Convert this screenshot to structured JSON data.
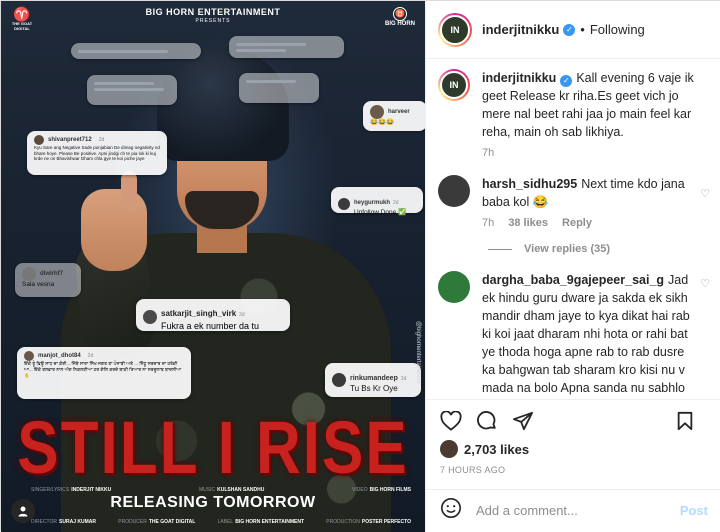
{
  "poster": {
    "presenter": "BIG HORN ENTERTAINMENT",
    "presents": "PRESENTS",
    "left_logo": "THE GOAT DIGITAL",
    "right_logo": "BIG HORN",
    "title": "STILL I RISE",
    "release_text": "RELEASING TOMORROW",
    "credits_top": [
      {
        "k": "SINGER/LYRICS",
        "v": "INDERJIT NIKKU"
      },
      {
        "k": "MUSIC",
        "v": "KULSHAN SANDHU"
      },
      {
        "k": "VIDEO",
        "v": "BIG HORN FILMS"
      }
    ],
    "credits_bottom": [
      {
        "k": "DIRECTOR",
        "v": "SURAJ KUMAR"
      },
      {
        "k": "PRODUCER",
        "v": "THE GOAT DIGITAL"
      },
      {
        "k": "LABEL",
        "v": "BIG HORN ENTERTAINMENT"
      },
      {
        "k": "PRODUCTION",
        "v": "POSTER PERFECTO"
      }
    ],
    "side_handle": "@bighornentertainment",
    "bubbles": {
      "b1_user": "harveer",
      "b2_user": "shivanpreet712",
      "b2_time": "2d",
      "b2_msg": "Kyu Sare ang Negative Sade punjabian De dimag negativity nd bhare hoye. Please Be positive. Apni jindgi ch te pia lok ki kuj krde ne on Bhavishwar Dham chla gye te koi piche jaye",
      "b3_user": "heygurmukh",
      "b3_time": "2d",
      "b3_msg": "Unfollow Done ✅",
      "b4_user": "dlwlrhf7",
      "b4_time": "2d",
      "b4_msg": "Sala vesna",
      "b5_user": "satkarjit_singh_virk",
      "b5_time": "2d",
      "b5_msg": "Fukra a ek number da tu",
      "b6_user": "manjot_dhot84",
      "b6_time": "2d",
      "b6_msg": "ਇੱਕੋ ਤੂੰ ਫਿਊ ਸਾਧ ਦਾ ਕੋਈ... ਜਿੱਥੇ ਸਾਰਾ ਸਿੱਖ ਜਗਤ ਤਾ ਪੰਜਾਬੀ ਅਤੇ ... ਸਿੱਧੂ ਸਰਦਾਰ ਦਾ ਹਰੇਕੀ ਆ... ਇੱਕੋ ਤਲਵਾਰ ਨਾਲ ਅੱਗ ਨਿਕਲਣੀਆ ਹਰ ਗੱਲਿ ਕਰਦੇ ਬਾਕੀ ਤਿਆਰ ਨਾ ਸਰਦੂਲਾਬ ਬਾਦਲੀਆ ✋",
      "b7_user": "rinkumandeep",
      "b7_time": "2d",
      "b7_msg": "Tu Bs Kr Oye"
    }
  },
  "header": {
    "username": "inderjitnikku",
    "separator": "•",
    "follow_state": "Following"
  },
  "caption": {
    "username": "inderjitnikku",
    "text": "Kall evening 6 vaje ik geet Release kr riha.Es geet vich jo mere nal beet rahi jaa jo main feel kar reha, main oh sab likhiya.",
    "time": "7h"
  },
  "comments": [
    {
      "username": "harsh_sidhu295",
      "text": "Next time kdo jana baba kol 😂",
      "time": "7h",
      "likes": "38 likes",
      "reply": "Reply",
      "view_replies": "View replies (35)",
      "avatar_color": "#3a3a3a"
    },
    {
      "username": "dargha_baba_9gajepeer_sai_g",
      "text": "Jad ek hindu guru dware ja sakda ek sikh mandir dham jaye to kya dikat hai rab ki koi jaat dharam nhi hota or rahi bat ye thoda hoga apne rab to rab dusre ka bahgwan tab sharam kro kisi nu v mada na bolo Apna sanda nu sabhlo changi gal a",
      "avatar_color": "#2f7a3a"
    }
  ],
  "actions": {
    "likes_count": "2,703 likes",
    "time_ago": "7 HOURS AGO"
  },
  "add_comment": {
    "placeholder": "Add a comment...",
    "post_label": "Post"
  },
  "colors": {
    "verified": "#3897f0",
    "title_red": "#c7221e",
    "post_disabled": "#b3dbff"
  }
}
